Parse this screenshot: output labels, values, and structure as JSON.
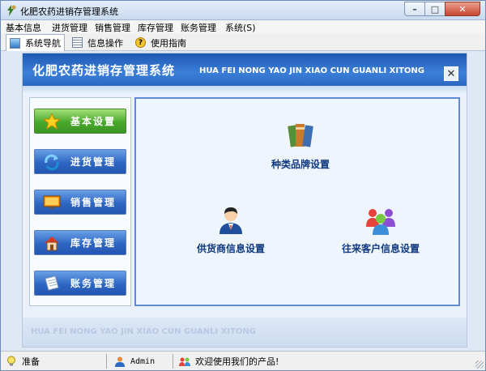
{
  "window": {
    "title": "化肥农药进销存管理系统"
  },
  "menubar": {
    "items": [
      "基本信息",
      "进货管理",
      "销售管理",
      "库存管理",
      "账务管理",
      "系统(S)"
    ]
  },
  "tabs": [
    {
      "label": "系统导航",
      "icon": "monitor-icon",
      "active": true
    },
    {
      "label": "信息操作",
      "icon": "document-icon",
      "active": false
    },
    {
      "label": "使用指南",
      "icon": "help-icon",
      "active": false
    }
  ],
  "banner": {
    "title_cn": "化肥农药进销存管理系统",
    "title_en": "HUA FEI NONG YAO JIN XIAO CUN GUANLI XITONG"
  },
  "nav": [
    {
      "label": "基本设置",
      "icon": "star-icon",
      "active": true
    },
    {
      "label": "进货管理",
      "icon": "refresh-arrow-icon",
      "active": false
    },
    {
      "label": "销售管理",
      "icon": "monitor-icon",
      "active": false
    },
    {
      "label": "库存管理",
      "icon": "house-icon",
      "active": false
    },
    {
      "label": "账务管理",
      "icon": "paper-icon",
      "active": false
    }
  ],
  "functions": [
    {
      "label": "种类品牌设置",
      "icon": "books-icon"
    },
    {
      "label": "供货商信息设置",
      "icon": "person-icon"
    },
    {
      "label": "往来客户信息设置",
      "icon": "group-icon"
    }
  ],
  "footer": {
    "watermark": "HUA FEI NONG YAO JIN XIAO CUN  GUANLI XITONG"
  },
  "status": {
    "state": "准备",
    "user": "Admin",
    "welcome": "欢迎使用我们的产品!"
  },
  "colors": {
    "banner": "#2b67c1",
    "nav_active": "#48a82b",
    "nav": "#2e66c4",
    "func_label": "#11397f"
  }
}
